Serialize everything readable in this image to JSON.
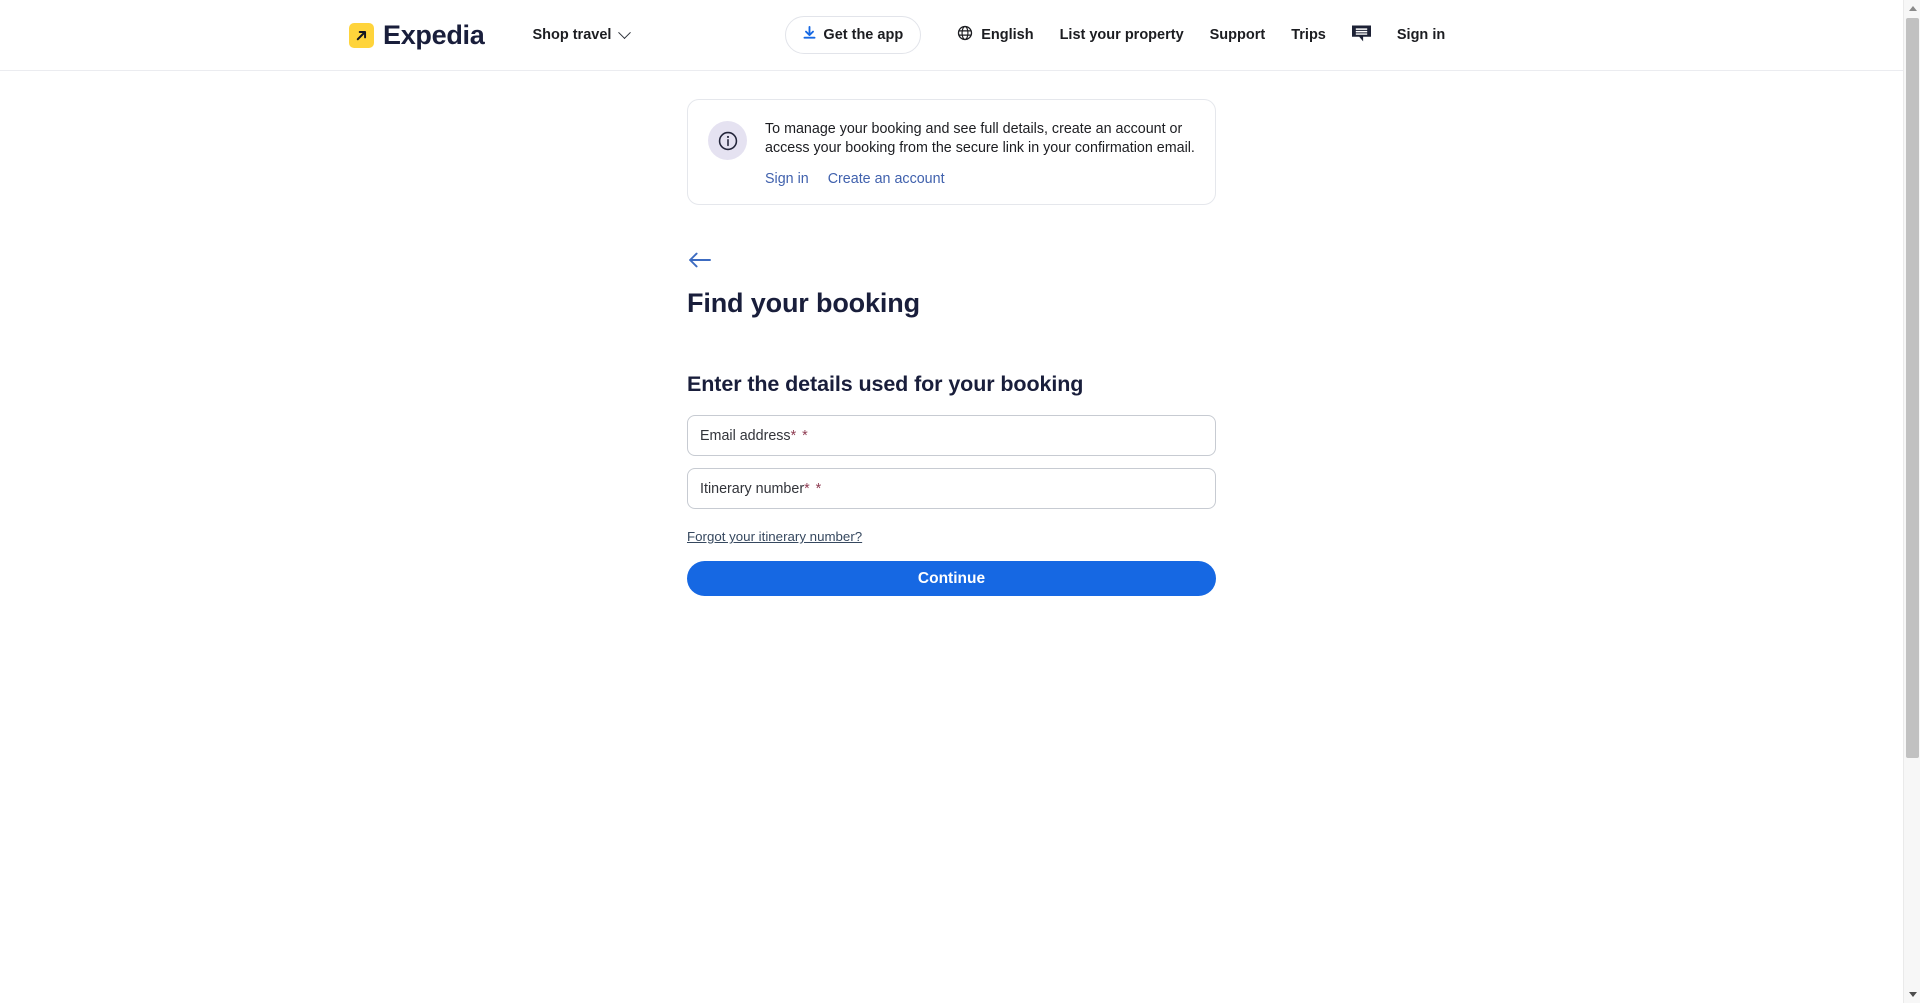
{
  "header": {
    "brand": {
      "name": "Expedia",
      "icon": "expedia-arrow-logo",
      "mark_color": "#ffd43b"
    },
    "shop_travel": {
      "label": "Shop travel",
      "icon": "chevron-down-icon"
    },
    "get_app": {
      "label": "Get the app",
      "icon": "download-icon",
      "icon_color": "#1668e3"
    },
    "language": {
      "label": "English",
      "icon": "globe-icon"
    },
    "list_property": {
      "label": "List your property"
    },
    "support": {
      "label": "Support"
    },
    "trips": {
      "label": "Trips"
    },
    "chat": {
      "icon": "chat-bubble-icon"
    },
    "sign_in": {
      "label": "Sign in"
    }
  },
  "banner": {
    "icon": "info-circle-icon",
    "icon_bg": "#e5e2f1",
    "text": "To manage your booking and see full details, create an account or access your booking from the secure link in your confirmation email.",
    "link_sign_in": "Sign in",
    "link_create_account": "Create an account",
    "link_color": "#4061ad"
  },
  "main": {
    "back_icon": "arrow-left-icon",
    "back_icon_color": "#3c6bc1",
    "page_title": "Find your booking",
    "form_title": "Enter the details used for your booking",
    "fields": [
      {
        "name": "email-address",
        "label": "Email address",
        "value": "",
        "placeholder": "Email address",
        "required_marks": "* *"
      },
      {
        "name": "itinerary-number",
        "label": "Itinerary number",
        "value": "",
        "placeholder": "Itinerary number",
        "required_marks": "* *"
      }
    ],
    "forgot_link": "Forgot your itinerary number?",
    "continue_label": "Continue",
    "continue_color": "#1668e3",
    "required_marker_color": "#8e3b52"
  }
}
